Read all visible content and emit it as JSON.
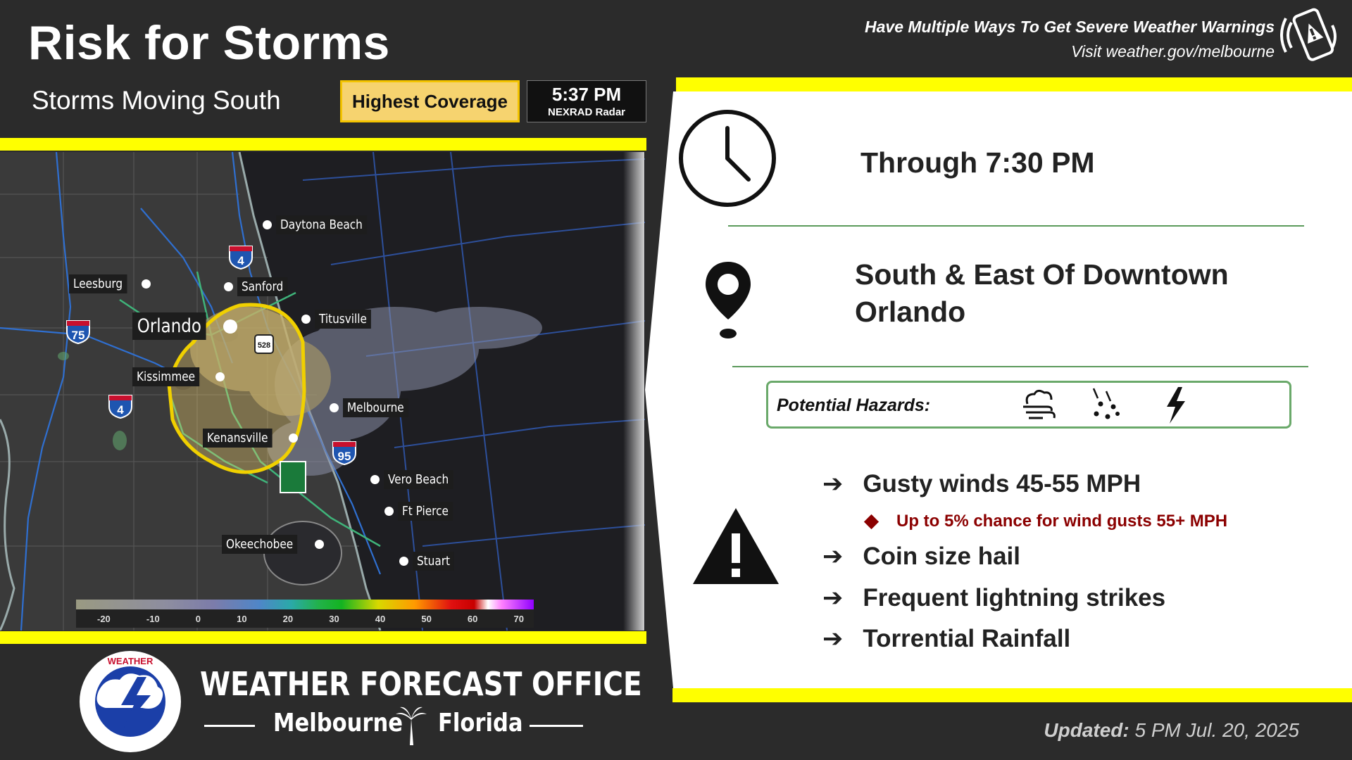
{
  "header": {
    "title": "Risk for Storms",
    "subtitle": "Storms Moving South",
    "coverage_label": "Highest Coverage",
    "radar_time": "5:37 PM",
    "radar_source": "NEXRAD Radar",
    "warning_line1": "Have Multiple Ways To Get Severe Weather Warnings",
    "warning_line2": "Visit weather.gov/melbourne"
  },
  "map": {
    "cities": {
      "daytona": "Daytona Beach",
      "leesburg": "Leesburg",
      "sanford": "Sanford",
      "orlando": "Orlando",
      "titusville": "Titusville",
      "kissimmee": "Kissimmee",
      "melbourne": "Melbourne",
      "kenansville": "Kenansville",
      "vero": "Vero Beach",
      "ftpierce": "Ft Pierce",
      "okeechobee": "Okeechobee",
      "stuart": "Stuart"
    },
    "highways": {
      "i4_north": "4",
      "i75": "75",
      "i4_west": "4",
      "i95": "95",
      "sr528": "528"
    },
    "scale_ticks": [
      "-20",
      "-10",
      "0",
      "10",
      "20",
      "30",
      "40",
      "50",
      "60",
      "70"
    ]
  },
  "panel": {
    "through": "Through 7:30 PM",
    "location": "South & East Of Downtown Orlando",
    "hazards_label": "Potential Hazards:",
    "hazard_icons": [
      "wind-rain-icon",
      "hail-icon",
      "lightning-icon"
    ],
    "bullets": [
      "Gusty winds 45-55 MPH",
      "Coin size hail",
      "Frequent lightning strikes",
      "Torrential Rainfall"
    ],
    "sub_bullet": "Up to 5% chance for wind gusts 55+ MPH"
  },
  "footer": {
    "office": "WEATHER FORECAST OFFICE",
    "city": "Melbourne",
    "state": "Florida",
    "updated_label": "Updated:",
    "updated_value": "5 PM Jul. 20, 2025"
  },
  "colors": {
    "accent_yellow": "#ffff00",
    "coverage_fill": "#f6d36f",
    "divider_green": "#5b9a5b",
    "sub_bullet_red": "#8b0000",
    "background": "#2b2b2b"
  }
}
